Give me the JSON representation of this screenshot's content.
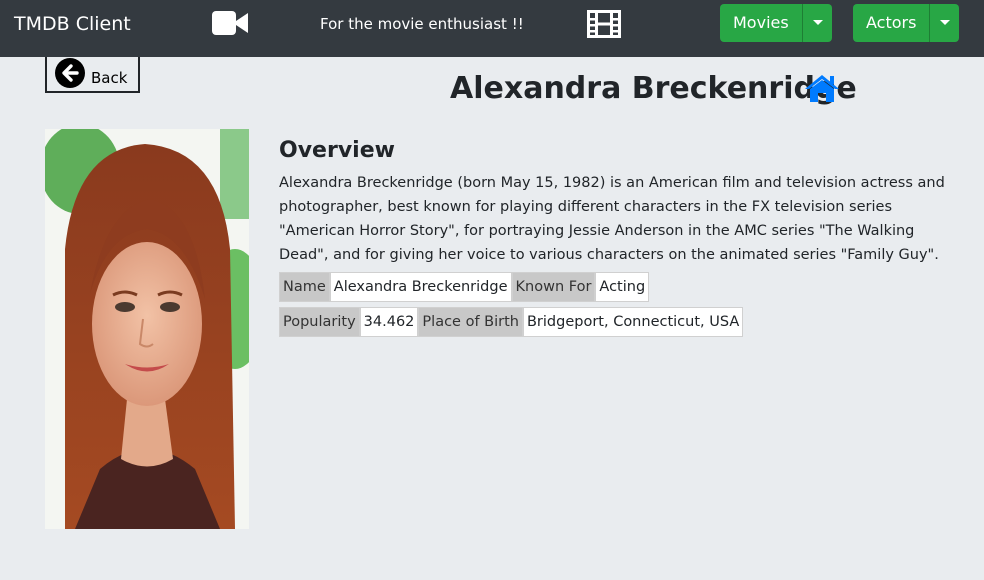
{
  "navbar": {
    "brand": "TMDB Client",
    "tagline": "For the movie enthusiast !!",
    "camera_icon": "video-camera-icon",
    "film_icon": "film-strip-icon",
    "buttons": [
      {
        "label": "Movies",
        "color": "#28a745"
      },
      {
        "label": "Actors",
        "color": "#28a745"
      }
    ]
  },
  "back": {
    "label": "Back",
    "icon": "arrow-left-circle-icon"
  },
  "title": "Alexandra Breckenridge",
  "home_icon": {
    "name": "home-icon",
    "color": "#007bff"
  },
  "overview": {
    "heading": "Overview",
    "text": "Alexandra Breckenridge (born May 15, 1982) is an American film and television actress and photographer, best known for playing different characters in the FX television series \"American Horror Story\", for portraying Jessie Anderson in the AMC series \"The Walking Dead\", and for giving her voice to various characters on the animated series \"Family Guy\"."
  },
  "details": {
    "row1": [
      {
        "key": "Name",
        "value": "Alexandra Breckenridge"
      },
      {
        "key": "Known For",
        "value": "Acting"
      }
    ],
    "row2": [
      {
        "key": "Popularity",
        "value": "34.462"
      },
      {
        "key": "Place of Birth",
        "value": "Bridgeport, Connecticut, USA"
      }
    ]
  }
}
